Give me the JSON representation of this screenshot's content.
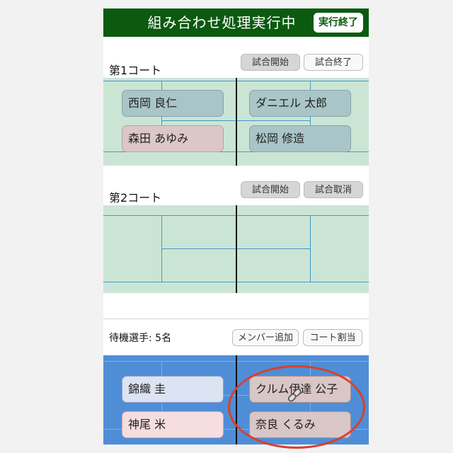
{
  "header": {
    "title": "組み合わせ処理実行中",
    "end_button": "実行終了"
  },
  "court1": {
    "label": "第1コート",
    "start_button": "試合開始",
    "end_button": "試合終了",
    "players": [
      "西岡 良仁",
      "ダニエル 太郎",
      "森田 あゆみ",
      "松岡 修造"
    ]
  },
  "court2": {
    "label": "第2コート",
    "start_button": "試合開始",
    "cancel_button": "試合取消"
  },
  "waiting": {
    "label": "待機選手: 5名",
    "add_member_button": "メンバー追加",
    "assign_court_button": "コート割当",
    "players": [
      "錦織 圭",
      "クルム伊達 公子",
      "神尾 米",
      "奈良 くるみ"
    ]
  },
  "colors": {
    "header": "#0b5a10",
    "court_green": "#cbe5d4",
    "court_blue": "#4f8ed6",
    "highlight_circle": "#d8402e"
  },
  "icons": {
    "link": "link-icon"
  }
}
